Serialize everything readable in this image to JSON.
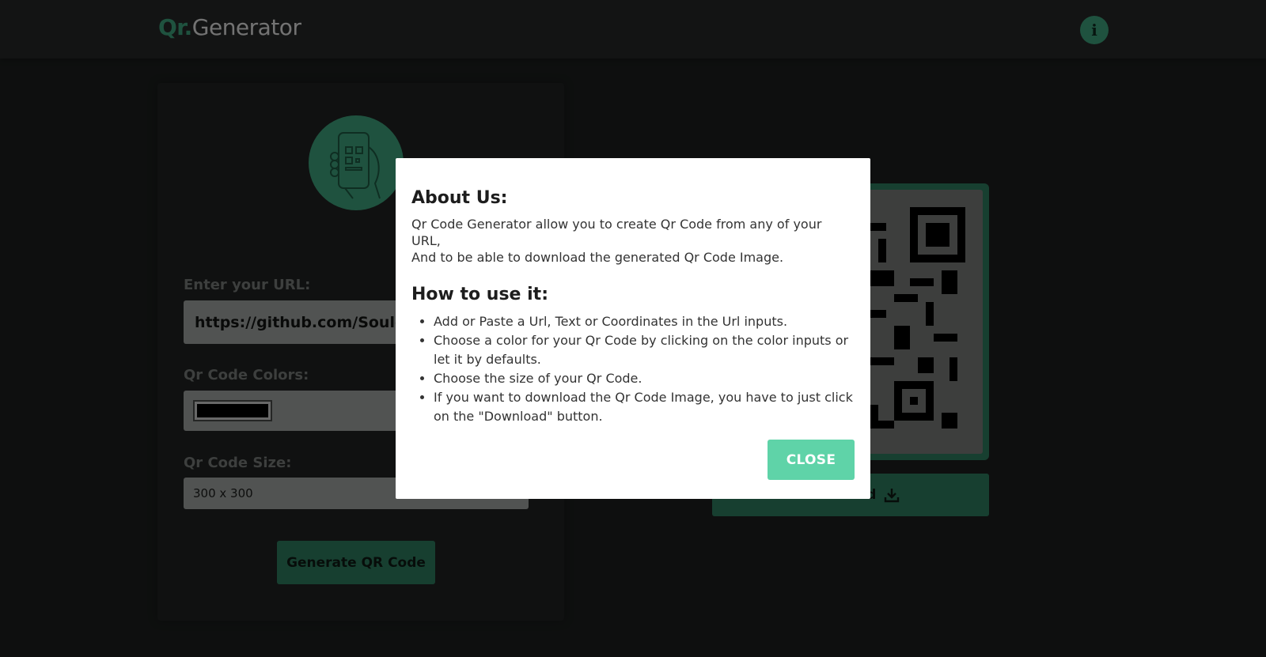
{
  "header": {
    "logo_accent": "Qr.",
    "logo_rest": "Generator",
    "info_icon": "i"
  },
  "form": {
    "hero_icon": "phone-qr-scan-icon",
    "url_label": "Enter your URL:",
    "url_value": "https://github.com/Souleym",
    "colors_label": "Qr Code Colors:",
    "color_value": "#000000",
    "size_label": "Qr Code Size:",
    "size_value": "300 x 300",
    "generate_label": "Generate QR Code"
  },
  "preview": {
    "download_label": "Download"
  },
  "modal": {
    "about_title": "About Us:",
    "about_line1": "Qr Code Generator allow you to create Qr Code from any of your URL,",
    "about_line2": "And to be able to download the generated Qr Code Image.",
    "howto_title": "How to use it:",
    "steps": [
      "Add or Paste a Url, Text or Coordinates in the Url inputs.",
      "Choose a color for your Qr Code by clicking on the color inputs or let it by defaults.",
      "Choose the size of your Qr Code.",
      "If you want to download the Qr Code Image, you have to just click on the \"Download\" button."
    ],
    "close_label": "CLOSE"
  },
  "colors": {
    "accent": "#3ea57f",
    "close_button": "#5fd3a8",
    "background": "#1c1f1e"
  }
}
